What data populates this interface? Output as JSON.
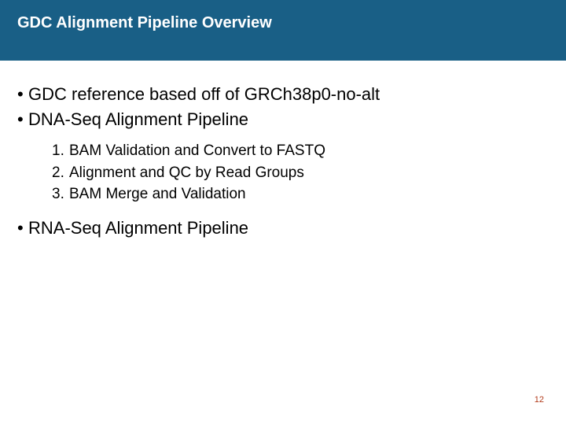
{
  "title": "GDC Alignment Pipeline Overview",
  "bullets": [
    {
      "text": "GDC reference based off of GRCh38p0-no-alt"
    },
    {
      "text": "DNA-Seq Alignment Pipeline"
    }
  ],
  "numbered": [
    {
      "n": "1.",
      "text": "BAM Validation and Convert to FASTQ"
    },
    {
      "n": "2.",
      "text": "Alignment and QC by Read Groups"
    },
    {
      "n": "3.",
      "text": "BAM Merge and Validation"
    }
  ],
  "bullets2": [
    {
      "text": "RNA-Seq Alignment Pipeline"
    }
  ],
  "pageNumber": "12",
  "bulletChar": "•"
}
